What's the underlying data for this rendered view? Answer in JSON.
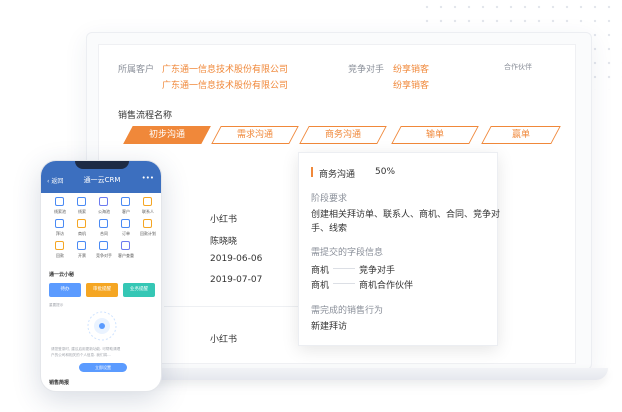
{
  "customer": {
    "label": "所属客户",
    "values": [
      "广东通一信息技术股份有限公司",
      "广东通一信息技术股份有限公司"
    ]
  },
  "competitor": {
    "label": "竞争对手",
    "values": [
      "纷享销客",
      "纷享销客"
    ],
    "partner_label": "合作伙伴"
  },
  "sales_process": {
    "title": "销售流程名称",
    "stages": [
      "初步沟通",
      "需求沟通",
      "商务沟通",
      "输单",
      "赢单"
    ],
    "active_index": 0
  },
  "details": {
    "name": "小红书",
    "owner": "陈晓晓",
    "date1": "2019-06-06",
    "date2": "2019-07-07",
    "name2": "小红书"
  },
  "popup": {
    "stage_name": "商务沟通",
    "percent": "50%",
    "requirements_title": "阶段要求",
    "requirements_text_1": "创建相关拜访单、联系人、商机、合同、竞争对",
    "requirements_text_2": "手、线索",
    "fields_title": "需提交的字段信息",
    "fields": [
      {
        "obj": "商机",
        "field": "竞争对手"
      },
      {
        "obj": "商机",
        "field": "商机合作伙伴"
      }
    ],
    "actions_title": "需完成的销售行为",
    "action": "新建拜访"
  },
  "phone": {
    "back": "返回",
    "title": "通一云CRM",
    "more": "•••",
    "apps": [
      {
        "label": "线索池",
        "icon": "clue-pool-icon",
        "color": "#4a8af4"
      },
      {
        "label": "线索",
        "icon": "clue-icon",
        "color": "#4a8af4"
      },
      {
        "label": "公海池",
        "icon": "sea-pool-icon",
        "color": "#6c7bf0"
      },
      {
        "label": "客户",
        "icon": "customer-icon",
        "color": "#4a8af4"
      },
      {
        "label": "联系人",
        "icon": "contact-icon",
        "color": "#f5a623"
      },
      {
        "label": "拜访",
        "icon": "visit-icon",
        "color": "#4a8af4"
      },
      {
        "label": "商机",
        "icon": "opportunity-icon",
        "color": "#f5a623"
      },
      {
        "label": "合同",
        "icon": "contract-icon",
        "color": "#4a8af4"
      },
      {
        "label": "订单",
        "icon": "order-icon",
        "color": "#4a8af4"
      },
      {
        "label": "回款计划",
        "icon": "payment-plan-icon",
        "color": "#f5a623"
      },
      {
        "label": "回款",
        "icon": "payment-icon",
        "color": "#f5a623"
      },
      {
        "label": "开票",
        "icon": "invoice-icon",
        "color": "#4a8af4"
      },
      {
        "label": "竞争对手",
        "icon": "competitor-icon",
        "color": "#4a8af4"
      },
      {
        "label": "客户查重",
        "icon": "dedupe-icon",
        "color": "#6c7bf0"
      }
    ],
    "section_title": "通一云小秘",
    "buttons": [
      {
        "label": "待办",
        "color": "#5b9bff"
      },
      {
        "label": "审批提醒",
        "color": "#f5a623"
      },
      {
        "label": "业务提醒",
        "color": "#35c7b5"
      }
    ],
    "hint_label": "重要提示",
    "body_text_1": "请您登录时, 建议启用更新功能. 可帮助清理",
    "body_text_2": "户的公司和相关的个人信息. 我们将...",
    "cta": "立即设置",
    "footer": "销售简报"
  }
}
